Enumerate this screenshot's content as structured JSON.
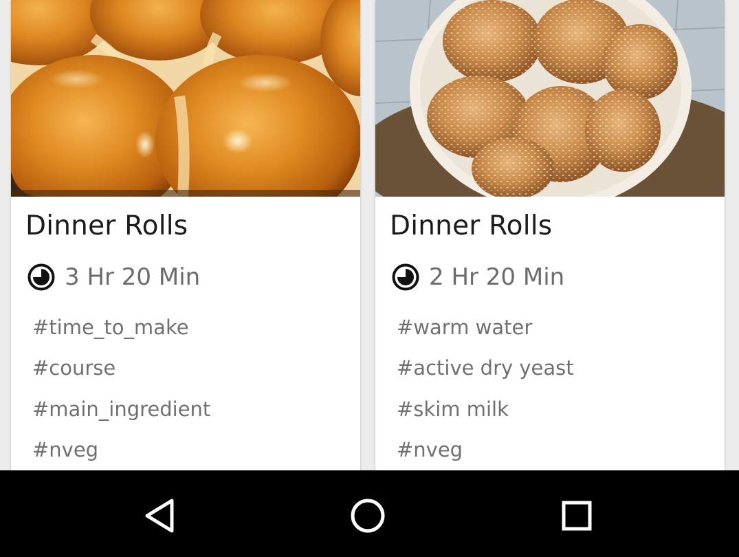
{
  "recipes": [
    {
      "title": "Dinner Rolls",
      "time": "3 Hr 20 Min",
      "tags": [
        "#time_to_make",
        "#course",
        "#main_ingredient",
        "#nveg"
      ],
      "photo_icon": "baked-rolls-in-pan-photo"
    },
    {
      "title": "Dinner Rolls",
      "time": "2 Hr 20 Min",
      "tags": [
        "#warm water",
        "#active dry yeast",
        "#skim milk",
        "#nveg"
      ],
      "photo_icon": "sesame-buns-on-plate-photo"
    }
  ],
  "navbar": {
    "back_icon": "back-triangle-icon",
    "home_icon": "home-circle-icon",
    "recents_icon": "recents-square-icon"
  },
  "colors": {
    "title": "#1b1b1b",
    "time": "#6b6b6b",
    "tag": "#707070",
    "navbar": "#000000",
    "card": "#ffffff",
    "background": "#ececec"
  }
}
